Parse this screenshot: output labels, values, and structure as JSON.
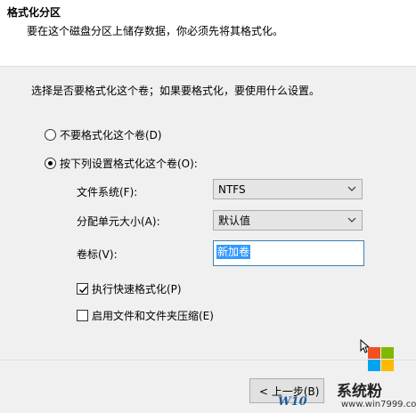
{
  "header": {
    "title": "格式化分区",
    "subtitle": "要在这个磁盘分区上储存数据，你必须先将其格式化。"
  },
  "question": "选择是否要格式化这个卷；如果要格式化，要使用什么设置。",
  "options": {
    "no_format": "不要格式化这个卷(D)",
    "format_with": "按下列设置格式化这个卷(O):"
  },
  "fields": {
    "filesystem_label": "文件系统(F):",
    "filesystem_value": "NTFS",
    "unit_size_label": "分配单元大小(A):",
    "unit_size_value": "默认值",
    "volume_label_label": "卷标(V):",
    "volume_label_value": "新加卷"
  },
  "checkboxes": {
    "quick_format": "执行快速格式化(P)",
    "compression": "启用文件和文件夹压缩(E)"
  },
  "buttons": {
    "back": "< 上一步(B)"
  },
  "watermark": {
    "brand": "系统粉",
    "url": "www.win7999.com",
    "w10": "W10"
  }
}
